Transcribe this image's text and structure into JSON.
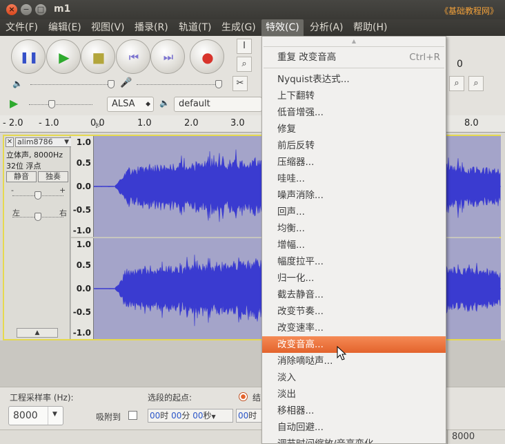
{
  "window": {
    "title": "m1",
    "watermark": "《基础教程网》",
    "close": "×",
    "minimize": "−",
    "maximize": "□"
  },
  "menubar": [
    "文件(F)",
    "编辑(E)",
    "视图(V)",
    "播录(R)",
    "轨道(T)",
    "生成(G)",
    "特效(C)",
    "分析(A)",
    "帮助(H)"
  ],
  "toolbar": {
    "host": "ALSA",
    "device": "default",
    "right_number": "0"
  },
  "ruler": {
    "labels": [
      "- 2.0",
      "- 1.0",
      "0.0",
      "1.0",
      "2.0",
      "3.0",
      "8.0"
    ]
  },
  "track": {
    "name": "alim8786",
    "info1": "立体声, 8000Hz",
    "info2": "32位 浮点",
    "mute": "静音",
    "solo": "独奏",
    "gain_min": "-",
    "gain_max": "+",
    "pan_left": "左",
    "pan_right": "右",
    "collapse": "▲",
    "close": "✕",
    "dropdown": "▼",
    "scale_top": [
      "1.0",
      "0.5",
      "0.0",
      "-0.5",
      "-1.0"
    ],
    "scale_bottom": [
      "1.0",
      "0.5",
      "0.0",
      "-0.5",
      "-1.0"
    ]
  },
  "selection": {
    "rate_label": "工程采样率 (Hz):",
    "rate_value": "8000",
    "snap_label": "吸附到",
    "start_label": "选段的起点:",
    "time_hh": "00",
    "time_h_unit": "时",
    "time_mm": "00",
    "time_m_unit": "分",
    "time_ss": "00",
    "time_s_unit": "秒",
    "time_2_hh": "00",
    "time_2_unit": "时",
    "end_label": "结"
  },
  "status": {
    "right_value": "8000"
  },
  "effects_menu": {
    "scroll_up": "▲",
    "repeat": "重复 改变音高",
    "repeat_shortcut": "Ctrl+R",
    "items": [
      "Nyquist表达式...",
      "上下翻转",
      "低音增强...",
      "修复",
      "前后反转",
      "压缩器...",
      "哇哇...",
      "噪声消除...",
      "回声...",
      "均衡...",
      "增幅...",
      "幅度拉平...",
      "归一化...",
      "截去静音...",
      "改变节奏...",
      "改变速率...",
      "改变音高...",
      "消除嘀哒声...",
      "淡入",
      "淡出",
      "移相器...",
      "自动回避...",
      "调节时间缩放/音高变化..."
    ],
    "highlighted_index": 16
  },
  "colors": {
    "accent": "#e3632c",
    "wave": "#3a3bd0",
    "wave_bg": "#a4a4c9"
  }
}
